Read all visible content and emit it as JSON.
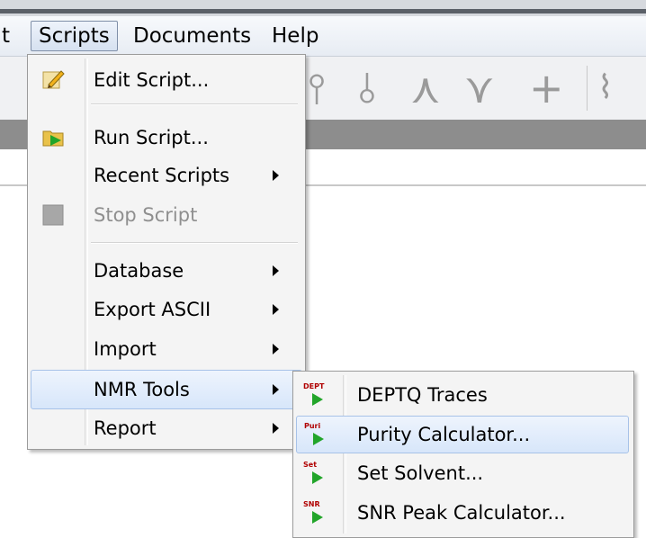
{
  "menubar": {
    "partial": "t",
    "scripts": "Scripts",
    "documents": "Documents",
    "help": "Help"
  },
  "scripts_menu": {
    "items": [
      {
        "label": "Edit Script...",
        "icon": "edit-script-icon"
      },
      {
        "label": "Run Script...",
        "icon": "run-script-icon"
      },
      {
        "label": "Recent Scripts",
        "submenu": true
      },
      {
        "label": "Stop Script",
        "icon": "stop-script-icon",
        "disabled": true
      },
      {
        "label": "Database",
        "submenu": true
      },
      {
        "label": "Export ASCII",
        "submenu": true
      },
      {
        "label": "Import",
        "submenu": true
      },
      {
        "label": "NMR Tools",
        "submenu": true,
        "highlighted": true
      },
      {
        "label": "Report",
        "submenu": true
      }
    ]
  },
  "nmr_tools_submenu": {
    "items": [
      {
        "label": "DEPTQ Traces",
        "icon_tag": "DEPT"
      },
      {
        "label": "Purity Calculator...",
        "icon_tag": "Puri",
        "highlighted": true
      },
      {
        "label": "Set Solvent...",
        "icon_tag": "Set"
      },
      {
        "label": "SNR Peak Calculator...",
        "icon_tag": "SNR"
      }
    ]
  },
  "colors": {
    "highlight": "#d7e6fa",
    "menu_bg": "#f4f4f4",
    "play_green": "#22a52a",
    "tag_red": "#b00000"
  }
}
